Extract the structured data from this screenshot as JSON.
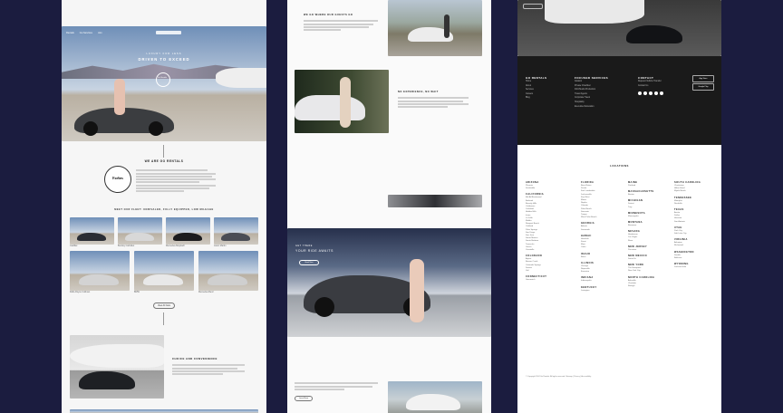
{
  "col1": {
    "nav": [
      "Rentals",
      "Go Services",
      "Join"
    ],
    "hero_eyebrow": "Luxury for Less",
    "hero_title": "Driven to Exceed",
    "hero_badge": "Go Rentals",
    "about_title": "We Are Go Rentals",
    "forbes_badge": "Forbes",
    "fleet_title": "Meet our fleet: Unrivaled, Fully Equipped, Low Mileage",
    "fleet_row1": [
      "Cadillac",
      "Bentley Cabriolet",
      "Mercedes-Maybach",
      "Aston Martin"
    ],
    "fleet_row2": [
      "Rolls-Royce Cullinan",
      "BMW",
      "Mercedes-Benz"
    ],
    "view_all": "View All Cars",
    "concierge_title": "Choice and Convenience"
  },
  "col2": {
    "where_title": "We Go Where Our Guests Go",
    "experience_title": "No Experience, No Wait",
    "cta_eyebrow": "Get there",
    "cta_title": "Your Ride Awaits",
    "cta_button": "Book Now",
    "learn_more": "Learn More"
  },
  "col3": {
    "footer": {
      "col1_title": "Go Rentals",
      "col1_items": [
        "Home",
        "About",
        "Services",
        "Careers",
        "Blog"
      ],
      "col2_title": "Focused Services",
      "col2_items": [
        "Aviation",
        "Private Chauffeur",
        "Film/Studio Production",
        "Travel Agents",
        "Corporate Travel",
        "Hospitality",
        "Executive Relocation"
      ],
      "col3_title": "Contact",
      "col3_items": [
        "Request Vehicle Transfer",
        "Contact Us"
      ],
      "app_store": "App Store",
      "google_play": "Google Play"
    },
    "locations_title": "Locations",
    "locations": [
      {
        "states": [
          {
            "name": "Arizona",
            "cities": [
              "Phoenix",
              "Scottsdale"
            ]
          },
          {
            "name": "California",
            "cities": [
              "Bel Air/Brentwood",
              "Burbank",
              "Beverly Hills",
              "Calabasas",
              "Carlsbad",
              "Hidden Hills",
              "Irvine",
              "La Jolla",
              "Malibu",
              "Newport Beach",
              "Oakland",
              "Palm Springs",
              "San Diego",
              "San Jose",
              "Santa Monica",
              "Santa Barbara",
              "Temecula",
              "Venice",
              "Yountville"
            ]
          },
          {
            "name": "Colorado",
            "cities": [
              "Aspen",
              "Beaver Creek",
              "Colorado Springs",
              "Denver",
              "Vail"
            ]
          },
          {
            "name": "Connecticut",
            "cities": [
              "Greenwich"
            ]
          }
        ]
      },
      {
        "states": [
          {
            "name": "Florida",
            "cities": [
              "Boca Raton",
              "Destin",
              "Fort Lauderdale",
              "Jacksonville",
              "Key West",
              "Miami",
              "Naples",
              "Orlando",
              "Palm Beach",
              "Sarasota",
              "Tampa",
              "West Palm Beach"
            ]
          },
          {
            "name": "Georgia",
            "cities": [
              "Atlanta",
              "Savannah"
            ]
          },
          {
            "name": "Hawaii",
            "cities": [
              "Honolulu",
              "Kauai",
              "Maui",
              "Oahu"
            ]
          },
          {
            "name": "Idaho",
            "cities": [
              "Boise"
            ]
          },
          {
            "name": "Illinois",
            "cities": [
              "Chicago",
              "Naperville",
              "Evanston"
            ]
          },
          {
            "name": "Indiana",
            "cities": [
              "Indianapolis"
            ]
          },
          {
            "name": "Kentucky",
            "cities": [
              "Lexington"
            ]
          }
        ]
      },
      {
        "states": [
          {
            "name": "Maine",
            "cities": [
              "Portland"
            ]
          },
          {
            "name": "Massachusetts",
            "cities": [
              "Boston"
            ]
          },
          {
            "name": "Michigan",
            "cities": [
              "Detroit",
              "Troy"
            ]
          },
          {
            "name": "Minnesota",
            "cities": [
              "Minneapolis"
            ]
          },
          {
            "name": "Montana",
            "cities": [
              "Bozeman"
            ]
          },
          {
            "name": "Nevada",
            "cities": [
              "Henderson",
              "Las Vegas",
              "Reno"
            ]
          },
          {
            "name": "New Jersey",
            "cities": [
              "Princeton"
            ]
          },
          {
            "name": "New Mexico",
            "cities": [
              "Santa Fe"
            ]
          },
          {
            "name": "New York",
            "cities": [
              "The Hamptons",
              "New York City"
            ]
          },
          {
            "name": "North Carolina",
            "cities": [
              "Asheville",
              "Charlotte",
              "Raleigh"
            ]
          }
        ]
      },
      {
        "states": [
          {
            "name": "South Carolina",
            "cities": [
              "Charleston",
              "Hilton Head",
              "Myrtle Beach"
            ]
          },
          {
            "name": "Tennessee",
            "cities": [
              "Memphis",
              "Nashville"
            ]
          },
          {
            "name": "Texas",
            "cities": [
              "Austin",
              "Dallas",
              "Houston",
              "San Antonio"
            ]
          },
          {
            "name": "Utah",
            "cities": [
              "Park City",
              "Salt Lake City"
            ]
          },
          {
            "name": "Virginia",
            "cities": [
              "Arlington",
              "Richmond"
            ]
          },
          {
            "name": "Washington",
            "cities": [
              "Seattle",
              "Bellevue"
            ]
          },
          {
            "name": "Wyoming",
            "cities": [
              "Jackson Hole"
            ]
          }
        ]
      }
    ],
    "copyright": "© Copyright 2024 Go Rentals. All rights reserved. Sitemap | Privacy | Accessibility"
  }
}
